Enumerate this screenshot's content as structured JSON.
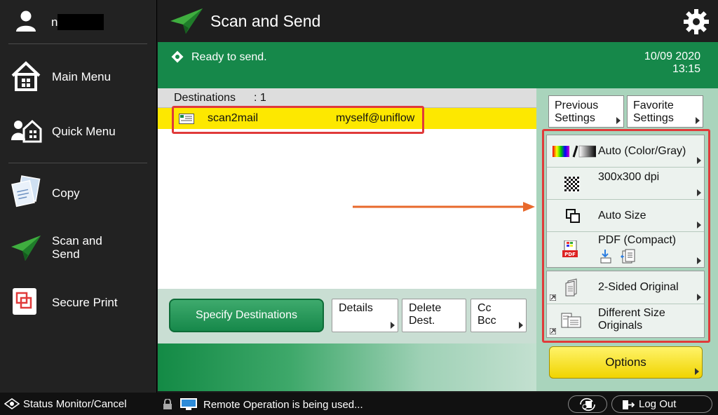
{
  "sidebar": {
    "user_initial": "n",
    "items": [
      {
        "label": "Main Menu"
      },
      {
        "label": "Quick Menu"
      },
      {
        "label": "Copy"
      },
      {
        "label": "Scan and Send"
      },
      {
        "label": "Secure Print"
      }
    ]
  },
  "header": {
    "title": "Scan and Send"
  },
  "status": {
    "message": "Ready to send.",
    "date": "10/09 2020",
    "time": "13:15"
  },
  "destinations": {
    "label": "Destinations",
    "count": ": 1",
    "rows": [
      {
        "name": "scan2mail",
        "address": "myself@uniflow"
      }
    ]
  },
  "actions": {
    "specify": "Specify Destinations",
    "details": "Details",
    "delete_l1": "Delete",
    "delete_l2": "Dest.",
    "cc_l1": "Cc",
    "cc_l2": "Bcc"
  },
  "rightpanel": {
    "previous_l1": "Previous",
    "previous_l2": "Settings",
    "favorite_l1": "Favorite",
    "favorite_l2": "Settings",
    "settings": [
      {
        "label": "Auto (Color/Gray)",
        "icon": "color-gray-icon"
      },
      {
        "label": "300x300 dpi",
        "icon": "resolution-icon"
      },
      {
        "label": "Auto Size",
        "icon": "scan-size-icon"
      },
      {
        "label": "PDF (Compact)",
        "icon": "pdf-icon"
      }
    ],
    "settings2": [
      {
        "label": "2-Sided Original",
        "icon": "two-sided-icon"
      },
      {
        "label_l1": "Different Size",
        "label_l2": "Originals",
        "icon": "different-size-icon"
      }
    ],
    "options": "Options"
  },
  "footer": {
    "status_monitor": "Status Monitor/Cancel",
    "remote": "Remote Operation is being used...",
    "logout": "Log Out"
  },
  "colors": {
    "accent_green": "#16884a",
    "highlight_yellow": "#fde800",
    "annotation_red": "#e03a3a",
    "annotation_orange": "#e8692c"
  }
}
